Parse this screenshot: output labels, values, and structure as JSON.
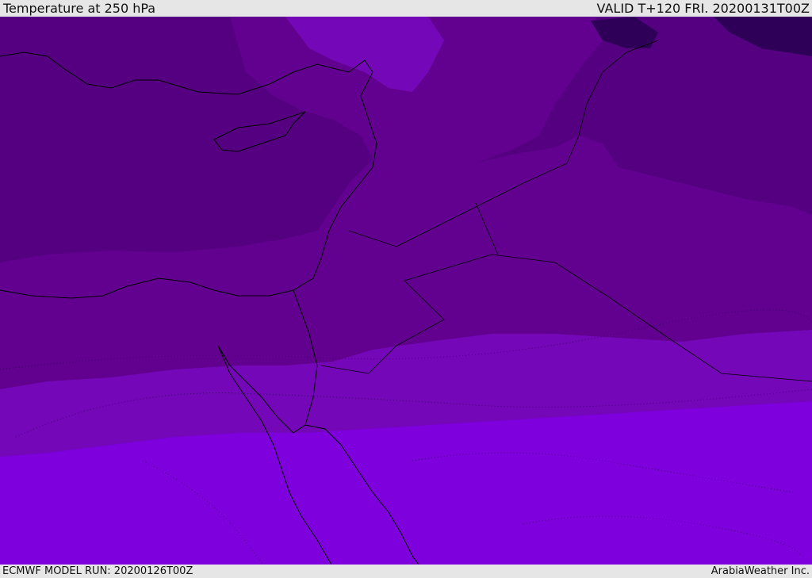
{
  "header": {
    "title": "Temperature at 250 hPa",
    "valid": "VALID T+120 FRI. 20200131T00Z"
  },
  "footer": {
    "model_run": "ECMWF MODEL RUN: 20200126T00Z",
    "credit": "ArabiaWeather Inc."
  },
  "map": {
    "colors": {
      "band_darkest": "#2f0058",
      "band_dark": "#540080",
      "band_mid_dark": "#620090",
      "band_mid": "#6c00a0",
      "band_light": "#7408b8",
      "band_brightest": "#7e00dd",
      "coast": "#000000"
    }
  }
}
